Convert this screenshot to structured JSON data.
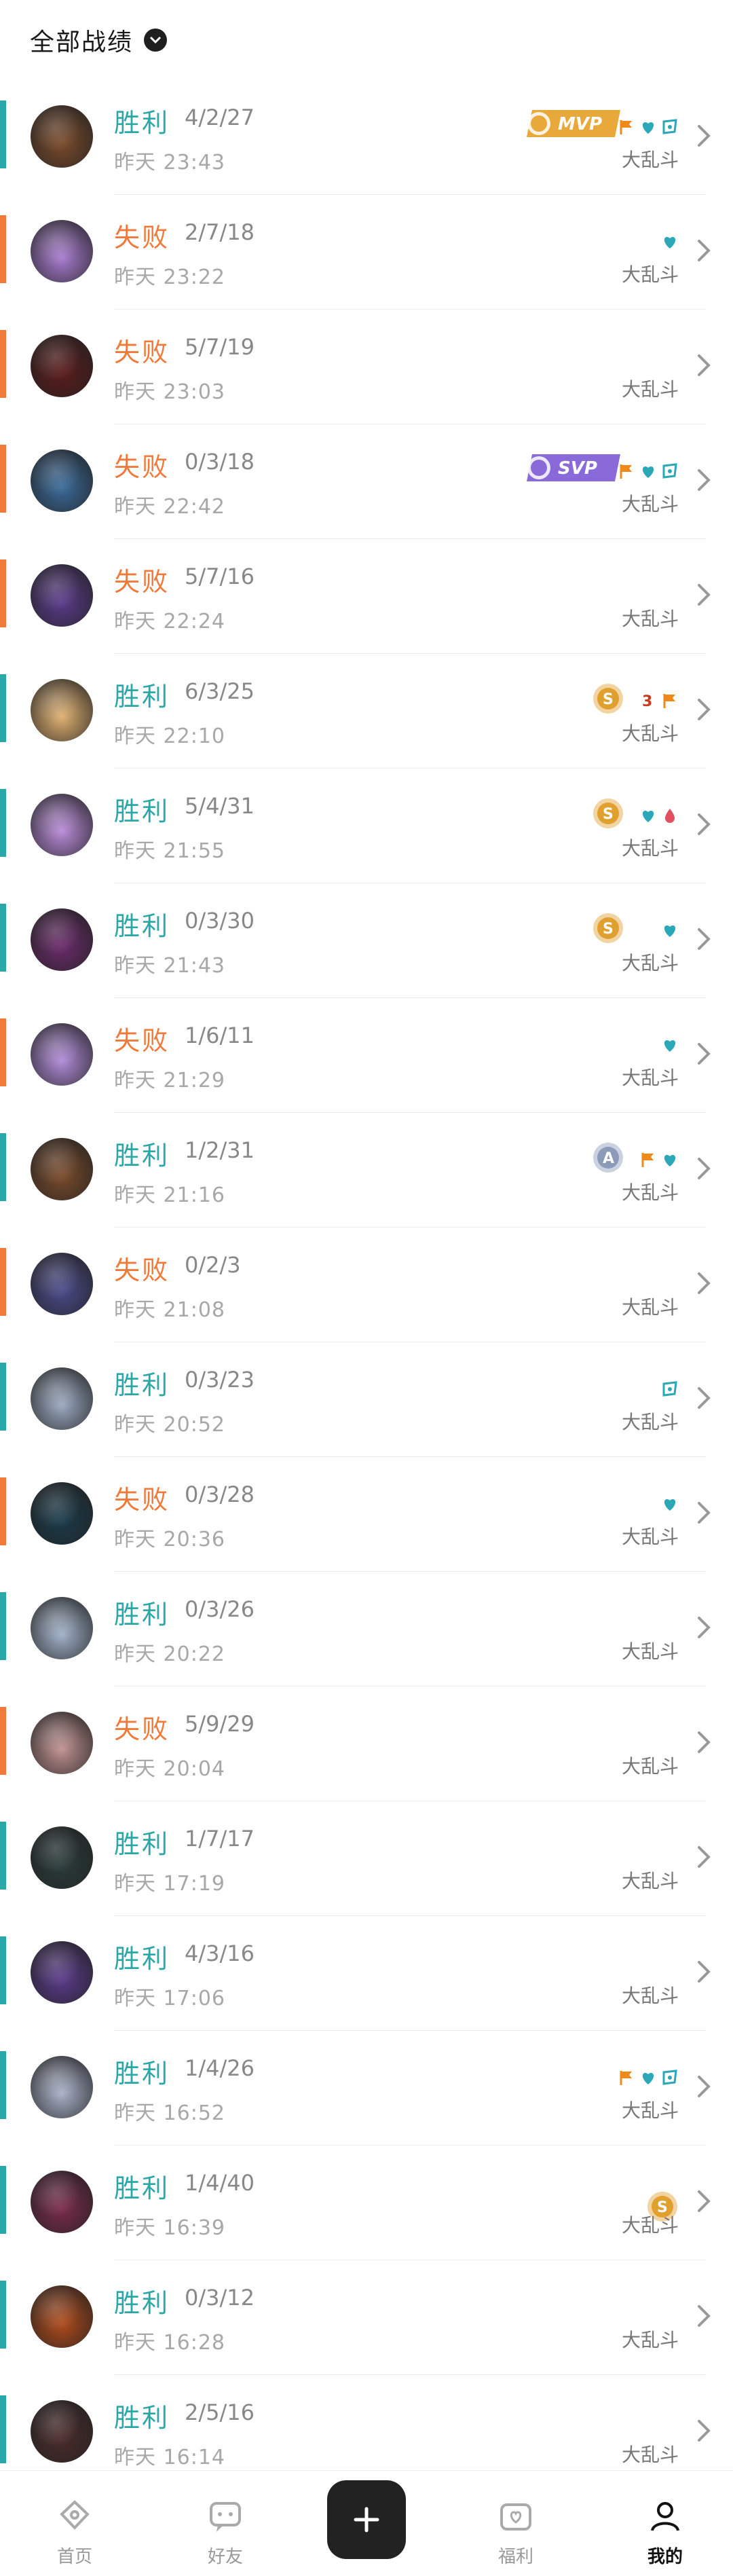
{
  "header": {
    "title": "全部战绩"
  },
  "matches": [
    {
      "result": "胜利",
      "outcome": "win",
      "kda": "4/2/27",
      "time": "昨天 23:43",
      "mode": "大乱斗",
      "badge": "MVP",
      "icons": [
        "flag",
        "heart",
        "shield"
      ],
      "hue": "#7a4a2a"
    },
    {
      "result": "失败",
      "outcome": "loss",
      "kda": "2/7/18",
      "time": "昨天 23:22",
      "mode": "大乱斗",
      "badge": "",
      "icons": [
        "heart"
      ],
      "hue": "#a87bd0"
    },
    {
      "result": "失败",
      "outcome": "loss",
      "kda": "5/7/19",
      "time": "昨天 23:03",
      "mode": "大乱斗",
      "badge": "",
      "icons": [],
      "hue": "#5a1a1a"
    },
    {
      "result": "失败",
      "outcome": "loss",
      "kda": "0/3/18",
      "time": "昨天 22:42",
      "mode": "大乱斗",
      "badge": "SVP",
      "icons": [
        "flag",
        "heart",
        "shield"
      ],
      "hue": "#3a6a9a"
    },
    {
      "result": "失败",
      "outcome": "loss",
      "kda": "5/7/16",
      "time": "昨天 22:24",
      "mode": "大乱斗",
      "badge": "",
      "icons": [],
      "hue": "#5a3a8a"
    },
    {
      "result": "胜利",
      "outcome": "win",
      "kda": "6/3/25",
      "time": "昨天 22:10",
      "mode": "大乱斗",
      "badge": "S",
      "icons": [
        "three",
        "flag"
      ],
      "hue": "#e0b070"
    },
    {
      "result": "胜利",
      "outcome": "win",
      "kda": "5/4/31",
      "time": "昨天 21:55",
      "mode": "大乱斗",
      "badge": "S",
      "icons": [
        "heart",
        "drop"
      ],
      "hue": "#b88ad8"
    },
    {
      "result": "胜利",
      "outcome": "win",
      "kda": "0/3/30",
      "time": "昨天 21:43",
      "mode": "大乱斗",
      "badge": "S",
      "icons": [
        "heart"
      ],
      "hue": "#6a2a6a"
    },
    {
      "result": "失败",
      "outcome": "loss",
      "kda": "1/6/11",
      "time": "昨天 21:29",
      "mode": "大乱斗",
      "badge": "",
      "icons": [
        "heart"
      ],
      "hue": "#b08ad8"
    },
    {
      "result": "胜利",
      "outcome": "win",
      "kda": "1/2/31",
      "time": "昨天 21:16",
      "mode": "大乱斗",
      "badge": "A",
      "icons": [
        "flag",
        "heart"
      ],
      "hue": "#7a4a2a"
    },
    {
      "result": "失败",
      "outcome": "loss",
      "kda": "0/2/3",
      "time": "昨天 21:08",
      "mode": "大乱斗",
      "badge": "",
      "icons": [],
      "hue": "#4a4a8a"
    },
    {
      "result": "胜利",
      "outcome": "win",
      "kda": "0/3/23",
      "time": "昨天 20:52",
      "mode": "大乱斗",
      "badge": "",
      "icons": [
        "shield"
      ],
      "hue": "#9aa8c0"
    },
    {
      "result": "失败",
      "outcome": "loss",
      "kda": "0/3/28",
      "time": "昨天 20:36",
      "mode": "大乱斗",
      "badge": "",
      "icons": [
        "heart"
      ],
      "hue": "#1a3a4a"
    },
    {
      "result": "胜利",
      "outcome": "win",
      "kda": "0/3/26",
      "time": "昨天 20:22",
      "mode": "大乱斗",
      "badge": "",
      "icons": [],
      "hue": "#a0b0c8"
    },
    {
      "result": "失败",
      "outcome": "loss",
      "kda": "5/9/29",
      "time": "昨天 20:04",
      "mode": "大乱斗",
      "badge": "",
      "icons": [],
      "hue": "#c09090"
    },
    {
      "result": "胜利",
      "outcome": "win",
      "kda": "1/7/17",
      "time": "昨天 17:19",
      "mode": "大乱斗",
      "badge": "",
      "icons": [],
      "hue": "#2a3a3a"
    },
    {
      "result": "胜利",
      "outcome": "win",
      "kda": "4/3/16",
      "time": "昨天 17:06",
      "mode": "大乱斗",
      "badge": "",
      "icons": [],
      "hue": "#5a3a8a"
    },
    {
      "result": "胜利",
      "outcome": "win",
      "kda": "1/4/26",
      "time": "昨天 16:52",
      "mode": "大乱斗",
      "badge": "",
      "icons": [
        "flag",
        "heart",
        "shield"
      ],
      "hue": "#a8b0c8"
    },
    {
      "result": "胜利",
      "outcome": "win",
      "kda": "1/4/40",
      "time": "昨天 16:39",
      "mode": "大乱斗",
      "badge": "S",
      "icons": [],
      "hue": "#7a2a4a"
    },
    {
      "result": "胜利",
      "outcome": "win",
      "kda": "0/3/12",
      "time": "昨天 16:28",
      "mode": "大乱斗",
      "badge": "",
      "icons": [],
      "hue": "#b04a1a"
    },
    {
      "result": "胜利",
      "outcome": "win",
      "kda": "2/5/16",
      "time": "昨天 16:14",
      "mode": "大乱斗",
      "badge": "",
      "icons": [],
      "hue": "#4a2a2a"
    }
  ],
  "tabbar": {
    "home": "首页",
    "friends": "好友",
    "welfare": "福利",
    "me": "我的"
  },
  "colors": {
    "win": "#2aa8a8",
    "loss": "#ef7a3a",
    "mvp": "#e8a93a",
    "svp": "#8a6ad8",
    "rank_s": "#e0a030",
    "rank_a": "#8a9ab8"
  }
}
